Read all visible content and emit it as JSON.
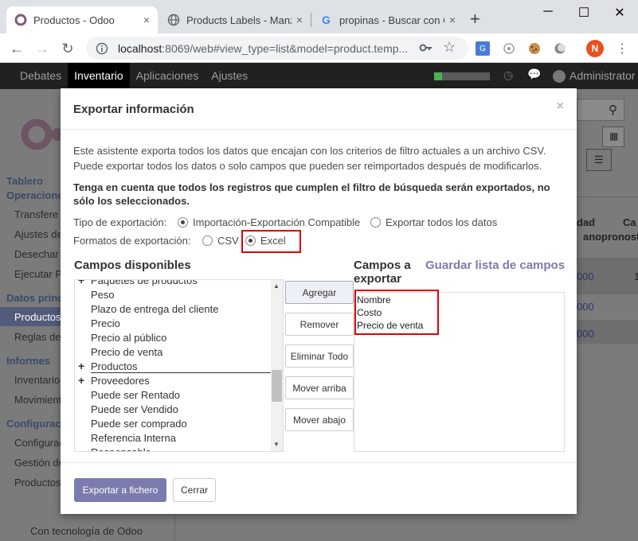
{
  "browser": {
    "tabs": [
      {
        "title": "Productos - Odoo",
        "close": "×"
      },
      {
        "title": "Products Labels - Manzano",
        "close": "×"
      },
      {
        "title": "propinas - Buscar con Google",
        "close": "×"
      }
    ],
    "new_tab": "+",
    "window": {
      "minimize": "─",
      "maximize": "☐",
      "close": "✕"
    },
    "url_host": "localhost",
    "url_path": ":8069/web#view_type=list&model=product.temp...",
    "profile_initial": "N"
  },
  "odoo": {
    "menus": [
      "Debates",
      "Inventario",
      "Aplicaciones",
      "Ajustes"
    ],
    "user": "Administrator",
    "sidebar": {
      "section1": "Tablero",
      "section1b": "Operacione",
      "items1": [
        "Transfere",
        "Ajustes de",
        "Desechar",
        "Ejecutar P"
      ],
      "section2": "Datos princ",
      "items2": [
        "Productos",
        "Reglas de"
      ],
      "section3": "Informes",
      "items3": [
        "Inventario",
        "Movimient"
      ],
      "section4": "Configurac",
      "items4": [
        "Configurac",
        "Gestión de",
        "Productos"
      ]
    },
    "powered": "Con tecnología de Odoo",
    "bg_col1": "dad",
    "bg_col1b": "ano",
    "bg_col2": "Ca",
    "bg_col2b": "pronost",
    "bg_vals": [
      "000",
      "000",
      "000"
    ],
    "bg_val_tail": "1"
  },
  "modal": {
    "title": "Exportar información",
    "close": "×",
    "intro1": "Este asistente exporta todos los datos que encajan con los criterios de filtro actuales a un archivo CSV.",
    "intro2": "Puede exportar todos los datos o solo campos que pueden ser reimportados después de modificarlos.",
    "warning1": "Tenga en cuenta que todos los registros que cumplen el filtro de búsqueda serán exportados, no",
    "warning2": "sólo los seleccionados.",
    "export_type_label": "Tipo de exportación:",
    "export_type_opt1": "Importación-Exportación Compatible",
    "export_type_opt2": "Exportar todos los datos",
    "format_label": "Formatos de exportación:",
    "format_csv": "CSV",
    "format_excel": "Excel",
    "available_title": "Campos disponibles",
    "available_fields": [
      {
        "label": "Paquetes de productos",
        "plus": true
      },
      {
        "label": "Peso",
        "plus": false
      },
      {
        "label": "Plazo de entrega del cliente",
        "plus": false
      },
      {
        "label": "Precio",
        "plus": false
      },
      {
        "label": "Precio al público",
        "plus": false
      },
      {
        "label": "Precio de venta",
        "plus": false
      },
      {
        "label": "Productos",
        "plus": true
      },
      {
        "label": "Proveedores",
        "plus": true
      },
      {
        "label": "Puede ser Rentado",
        "plus": false
      },
      {
        "label": "Puede ser Vendido",
        "plus": false
      },
      {
        "label": "Puede ser comprado",
        "plus": false
      },
      {
        "label": "Referencia Interna",
        "plus": false
      },
      {
        "label": "Responsable",
        "plus": false
      }
    ],
    "buttons": {
      "add": "Agregar",
      "remove": "Remover",
      "remove_all": "Eliminar Todo",
      "move_up": "Mover arriba",
      "move_down": "Mover abajo"
    },
    "export_title_1": "Campos a",
    "export_title_2": "exportar",
    "save_list": "Guardar lista de campos",
    "export_fields": [
      "Nombre",
      "Costo",
      "Precio de venta"
    ],
    "export_button": "Exportar a fichero",
    "close_button": "Cerrar"
  },
  "colors": {
    "odoo_primary": "#7c7bad",
    "highlight_red": "#e00000",
    "nav_bg": "#212121"
  }
}
